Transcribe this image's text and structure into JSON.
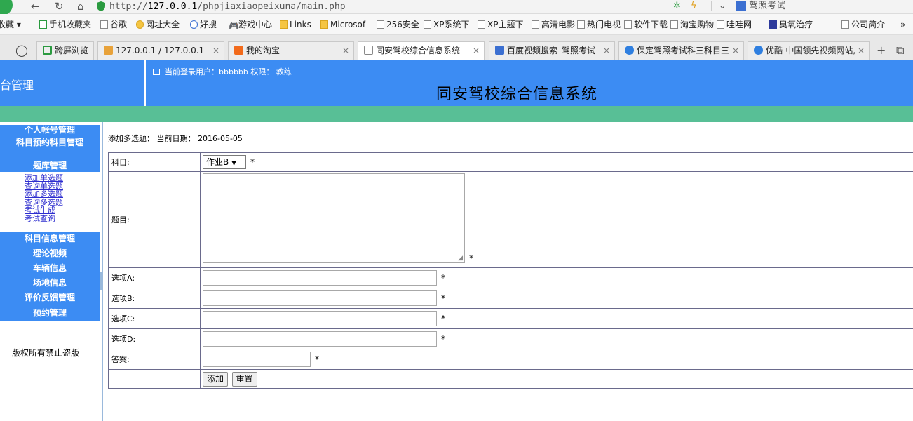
{
  "browser": {
    "url_prefix": "http://",
    "url_host": "127.0.0.1",
    "url_path": "/phpjiaxiaopeixuna/main.php",
    "search_text": "驾照考试",
    "bookmarks": [
      {
        "label": "收藏 ▾"
      },
      {
        "label": "手机收藏夹"
      },
      {
        "label": "谷歌"
      },
      {
        "label": "网址大全"
      },
      {
        "label": "好搜"
      },
      {
        "label": "游戏中心"
      },
      {
        "label": "Links"
      },
      {
        "label": "Microsof"
      },
      {
        "label": "256安全"
      },
      {
        "label": "XP系统下"
      },
      {
        "label": "XP主题下"
      },
      {
        "label": "高清电影"
      },
      {
        "label": "热门电视"
      },
      {
        "label": "软件下载"
      },
      {
        "label": "淘宝购物"
      },
      {
        "label": "哇哇网 -"
      },
      {
        "label": "臭氧治疗"
      },
      {
        "label": "公司简介"
      },
      {
        "label": "»"
      }
    ],
    "tabs": [
      {
        "label": "跨屏浏览"
      },
      {
        "label": "127.0.0.1 / 127.0.0.1"
      },
      {
        "label": "我的淘宝"
      },
      {
        "label": "同安驾校综合信息系统"
      },
      {
        "label": "百度视频搜索_驾照考试"
      },
      {
        "label": "保定驾照考试科三科目三"
      },
      {
        "label": "优酷-中国领先视频网站,"
      }
    ]
  },
  "header": {
    "left_title": "台管理",
    "user_label": "当前登录用户：",
    "user_name": "bbbbbb",
    "role_label": "权限：",
    "role": "教练",
    "system_title": "同安驾校综合信息系统"
  },
  "sidebar": {
    "sections": [
      {
        "label": "个人帐号管理"
      },
      {
        "label": "科目预约科目管理"
      },
      {
        "label": "题库管理"
      },
      {
        "label": "科目信息管理"
      },
      {
        "label": "理论视频"
      },
      {
        "label": "车辆信息"
      },
      {
        "label": "场地信息"
      },
      {
        "label": "评价反馈管理"
      },
      {
        "label": "预约管理"
      }
    ],
    "links": [
      {
        "label": "添加单选题"
      },
      {
        "label": "查询单选题"
      },
      {
        "label": "添加多选题"
      },
      {
        "label": "查询多选题"
      },
      {
        "label": "考试生成"
      },
      {
        "label": "考试查询"
      }
    ],
    "copyright": "版权所有禁止盗版"
  },
  "main": {
    "page_label": "添加多选题：",
    "date_label": "当前日期：",
    "date": "2016-05-05",
    "form": {
      "subject_label": "科目:",
      "subject_value": "作业B",
      "question_label": "题目:",
      "option_a_label": "选项A:",
      "option_b_label": "选项B:",
      "option_c_label": "选项C:",
      "option_d_label": "选项D:",
      "answer_label": "答案:",
      "required_mark": "*",
      "submit_label": "添加",
      "reset_label": "重置"
    }
  }
}
